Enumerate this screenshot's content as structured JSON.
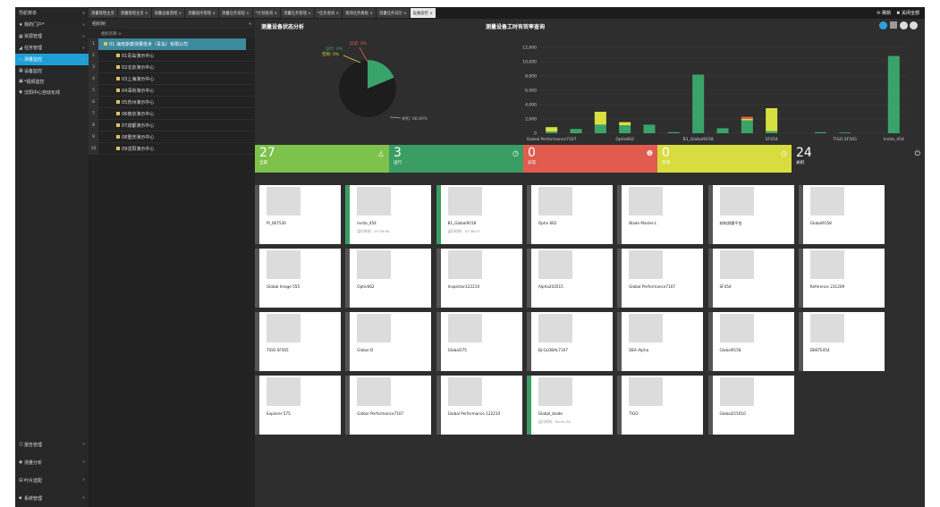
{
  "topbar": {
    "nav_title": "导航菜单",
    "collapse": "«",
    "tabs": [
      "测量管理主页",
      "测量管理主页 ×",
      "测量设备管理 ×",
      "测量程序管理 ×",
      "测量任务排程 ×",
      "*计划查询 ×",
      "测量任务管理 ×",
      "*任务查询 ×",
      "现场任务看板 ×",
      "测量任务日历 ×",
      "设备监控 ×"
    ],
    "refresh": "刷新",
    "close_all": "关闭全部"
  },
  "sidebar": {
    "items": [
      {
        "label": "我的门户*",
        "icon": "♦",
        "chev": "»"
      },
      {
        "label": "资源管理",
        "icon": "▦",
        "chev": "»"
      },
      {
        "label": "任务管理",
        "icon": "◢",
        "chev": "»"
      },
      {
        "label": "测量监控",
        "icon": "▭",
        "chev": "»"
      },
      {
        "label": "设备监控",
        "icon": "▦",
        "chev": ""
      },
      {
        "label": "*视频监控",
        "icon": "▣",
        "chev": ""
      },
      {
        "label": "沈阳中心自动化线",
        "icon": "◉",
        "chev": ""
      }
    ],
    "bottom": [
      {
        "label": "报告管理",
        "icon": "◫",
        "chev": "»"
      },
      {
        "label": "测量分析",
        "icon": "◉",
        "chev": "»"
      },
      {
        "label": "叶片选配",
        "icon": "▤",
        "chev": "»"
      },
      {
        "label": "系统管理",
        "icon": "▪",
        "chev": "»"
      }
    ]
  },
  "tree": {
    "title": "组织树",
    "collapse": "«",
    "col": "组织名称 ≎",
    "rows": [
      "01 海克斯康测量技术（青岛）有限公司",
      "01青岛演示中心",
      "02北京演示中心",
      "03上海演示中心",
      "04深圳演示中心",
      "05苏州演示中心",
      "06南京演示中心",
      "07成都演示中心",
      "08重庆演示中心",
      "09沈阳演示中心"
    ],
    "nums": [
      "1",
      "2",
      "3",
      "4",
      "5",
      "6",
      "7",
      "8",
      "9",
      "10"
    ]
  },
  "status_panel": {
    "title": "测量设备状态分析",
    "pie": {
      "labels": [
        "空闲: 0%",
        "运行: 0%",
        "异常: 0%",
        "关机: 88.89%"
      ]
    }
  },
  "efficiency_panel": {
    "title": "测量设备工时有效率查询"
  },
  "chart_data": {
    "type": "bar",
    "ylim": [
      0,
      12000
    ],
    "yticks": [
      "12,000",
      "10,000",
      "8,000",
      "6,000",
      "4,000",
      "2,000",
      "0"
    ],
    "categories": [
      "Global Performance7107",
      "Optiv662",
      "B1_Global9158",
      "SF454",
      "TIGO SF565",
      "Insite_454"
    ],
    "series": [
      {
        "color": "#3aa36a",
        "values": [
          250,
          600,
          1200,
          1100,
          1200,
          150,
          8200,
          700,
          1800,
          300,
          0,
          150,
          100,
          0,
          10800
        ]
      },
      {
        "color": "#d8e040",
        "values": [
          600,
          0,
          1800,
          450,
          0,
          0,
          0,
          0,
          200,
          3200,
          0,
          0,
          0,
          0,
          0
        ]
      },
      {
        "color": "#e15b4f",
        "values": [
          0,
          0,
          0,
          0,
          0,
          0,
          0,
          0,
          300,
          0,
          0,
          0,
          0,
          0,
          0
        ]
      }
    ]
  },
  "status": [
    {
      "value": "27",
      "label": "全部",
      "color": "#7dc24a",
      "icon": "⏃"
    },
    {
      "value": "3",
      "label": "运行",
      "color": "#3a9d63",
      "icon": "◷"
    },
    {
      "value": "0",
      "label": "异常",
      "color": "#e15b4f",
      "icon": "❶"
    },
    {
      "value": "0",
      "label": "空闲",
      "color": "#d8dc3e",
      "icon": "◷"
    },
    {
      "value": "24",
      "label": "关机",
      "color": "#2e2e2e",
      "icon": "⏻"
    }
  ],
  "cards": [
    {
      "name": "PI_067530",
      "run": ""
    },
    {
      "name": "Insite_454",
      "run": "运行时间：07:39:00"
    },
    {
      "name": "B1_Global9158",
      "run": "运行时间：07:36:17"
    },
    {
      "name": "Optiv 662",
      "run": ""
    },
    {
      "name": "Blade Master-L",
      "run": ""
    },
    {
      "name": "结构测量平台",
      "run": ""
    },
    {
      "name": "Global9158",
      "run": ""
    },
    {
      "name": "Global Image 555",
      "run": ""
    },
    {
      "name": "Optiv662",
      "run": ""
    },
    {
      "name": "Inspector122210",
      "run": ""
    },
    {
      "name": "Alpha203515",
      "run": ""
    },
    {
      "name": "Global Performance7107",
      "run": ""
    },
    {
      "name": "SF454",
      "run": ""
    },
    {
      "name": "Reference 231209",
      "run": ""
    },
    {
      "name": "TIGO SF565",
      "run": ""
    },
    {
      "name": "Global D",
      "run": ""
    },
    {
      "name": "Global575",
      "run": ""
    },
    {
      "name": "BJ-GLOBAL7107",
      "run": ""
    },
    {
      "name": "DEA Alpha",
      "run": ""
    },
    {
      "name": "Global9158",
      "run": ""
    },
    {
      "name": "DBSTE454",
      "run": ""
    },
    {
      "name": "Explorer 575",
      "run": ""
    },
    {
      "name": "Global Performance7107",
      "run": ""
    },
    {
      "name": "Global Performance 122210",
      "run": ""
    },
    {
      "name": "Global_blade",
      "run": "运行时间：00:01:30"
    },
    {
      "name": "TIGO",
      "run": ""
    },
    {
      "name": "Global215010",
      "run": ""
    }
  ]
}
